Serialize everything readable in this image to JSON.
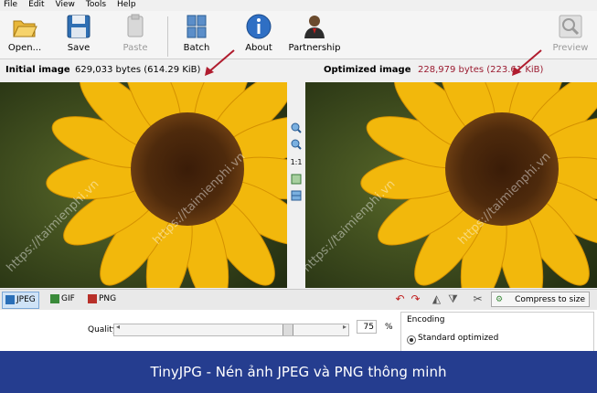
{
  "menu": [
    "File",
    "Edit",
    "View",
    "Tools",
    "Help"
  ],
  "toolbar": {
    "open": "Open...",
    "save": "Save",
    "paste": "Paste",
    "batch": "Batch",
    "about": "About",
    "partnership": "Partnership",
    "preview": "Preview"
  },
  "initial": {
    "label": "Initial image",
    "size": "629,033 bytes (614.29 KiB)"
  },
  "optimized": {
    "label": "Optimized image",
    "size": "228,979 bytes (223.61 KiB)"
  },
  "watermark": "https://taimienphi.vn",
  "zoom_label": "1:1",
  "formats": {
    "jpeg": "JPEG",
    "gif": "GIF",
    "png": "PNG"
  },
  "compress_button": "Compress to size",
  "settings": {
    "quality_label": "Quality:",
    "quality_value": "75",
    "quality_unit": "%",
    "encoding_label": "Encoding",
    "encoding_option": "Standard optimized"
  },
  "caption": "TinyJPG - Nén ảnh JPEG và PNG thông minh",
  "colors": {
    "banner": "#253d8f",
    "size_initial": "#000000",
    "size_optimized": "#9b1b30",
    "arrow": "#b01c2e"
  }
}
